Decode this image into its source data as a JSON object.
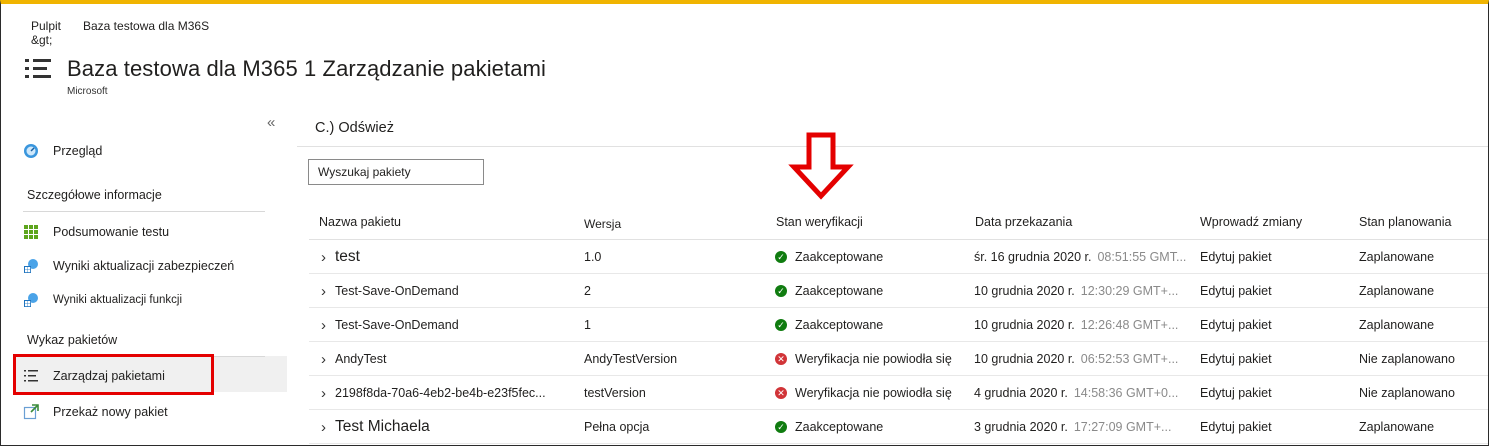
{
  "breadcrumb": {
    "home": "Pulpit &gt;",
    "current": "Baza testowa dla M36S"
  },
  "header": {
    "title": "Baza testowa dla M365 1 Zarządzanie pakietami",
    "subtitle": "Microsoft",
    "collapse_label": "«"
  },
  "sidebar": {
    "overview": "Przegląd",
    "details_section": "Szczegółowe informacje",
    "test_summary": "Podsumowanie testu",
    "security_results": "Wyniki aktualizacji zabezpieczeń",
    "feature_results": "Wyniki aktualizacji funkcji",
    "packages_section": "Wykaz pakietów",
    "manage_packages": "Zarządzaj pakietami",
    "upload_package": "Przekaż nowy pakiet"
  },
  "toolbar": {
    "refresh_label": "C.) Odśwież"
  },
  "search": {
    "value": "Wyszukaj pakiety"
  },
  "table": {
    "columns": [
      "Nazwa pakietu",
      "Wersja",
      "Stan weryfikacji",
      "Data przekazania",
      "Wprowadź zmiany",
      "Stan planowania"
    ],
    "rows": [
      {
        "name": "test",
        "version": "1.0",
        "status": "Zaakceptowane",
        "status_type": "ok",
        "date": "śr. 16 grudnia 2020 r.",
        "time": "08:51:55 GMT...",
        "edit": "Edytuj pakiet",
        "plan": "Zaplanowane"
      },
      {
        "name": "Test-Save-OnDemand",
        "version": "2",
        "status": "Zaakceptowane",
        "status_type": "ok",
        "date": "10 grudnia 2020 r.",
        "time": "12:30:29 GMT+...",
        "edit": "Edytuj pakiet",
        "plan": "Zaplanowane"
      },
      {
        "name": "Test-Save-OnDemand",
        "version": "1",
        "status": "Zaakceptowane",
        "status_type": "ok",
        "date": "10 grudnia 2020 r.",
        "time": "12:26:48 GMT+...",
        "edit": "Edytuj pakiet",
        "plan": "Zaplanowane"
      },
      {
        "name": "AndyTest",
        "version": "AndyTestVersion",
        "status": "Weryfikacja nie powiodła się",
        "status_type": "fail",
        "date": "10 grudnia 2020 r.",
        "time": "06:52:53 GMT+...",
        "edit": "Edytuj pakiet",
        "plan": "Nie zaplanowano"
      },
      {
        "name": "2198f8da-70a6-4eb2-be4b-e23f5fec...",
        "version": "testVersion",
        "status": "Weryfikacja nie powiodła się",
        "status_type": "fail",
        "date": "4 grudnia 2020 r.",
        "time": "14:58:36 GMT+0...",
        "edit": "Edytuj pakiet",
        "plan": "Nie zaplanowano"
      },
      {
        "name": "Test Michaela",
        "version": "Pełna opcja",
        "status": "Zaakceptowane",
        "status_type": "ok",
        "date": "3 grudnia 2020 r.",
        "time": "17:27:09 GMT+...",
        "edit": "Edytuj pakiet",
        "plan": "Zaplanowane"
      }
    ]
  },
  "colors": {
    "accent_top": "#f0b400",
    "ok": "#107c10",
    "fail": "#d13438",
    "highlight": "#e40000"
  }
}
